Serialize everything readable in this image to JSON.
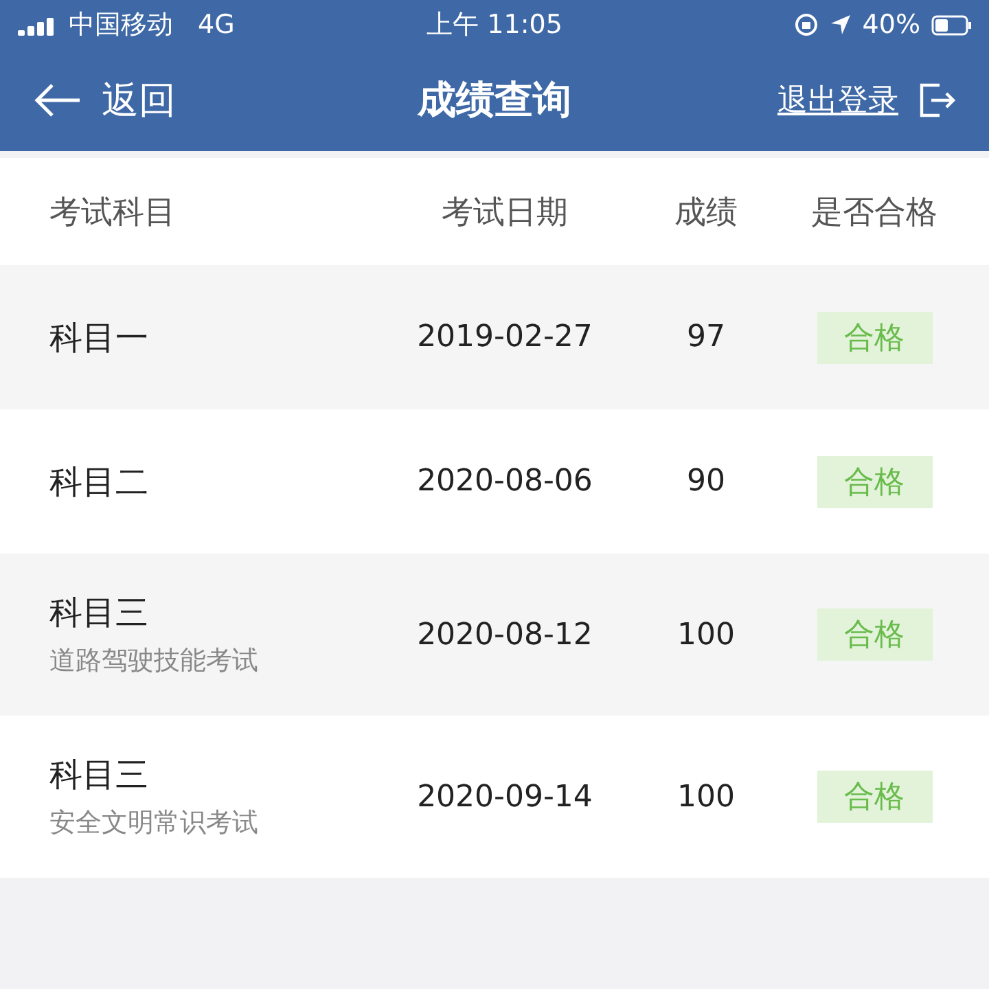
{
  "status_bar": {
    "carrier": "中国移动",
    "network": "4G",
    "time": "上午 11:05",
    "battery": "40%"
  },
  "nav": {
    "back": "返回",
    "title": "成绩查询",
    "logout": "退出登录"
  },
  "table": {
    "columns": [
      "考试科目",
      "考试日期",
      "成绩",
      "是否合格"
    ],
    "rows": [
      {
        "subject": "科目一",
        "date": "2019-02-27",
        "score": "97",
        "result": "合格",
        "passed": true
      },
      {
        "subject": "科目二",
        "date": "2020-08-06",
        "score": "90",
        "result": "合格",
        "passed": true
      },
      {
        "subject": "科目三",
        "note": "道路驾驶技能考试",
        "date": "2020-08-12",
        "score": "100",
        "result": "合格",
        "passed": true
      },
      {
        "subject": "科目三",
        "note": "安全文明常识考试",
        "date": "2020-09-14",
        "score": "100",
        "result": "合格",
        "passed": true
      }
    ]
  }
}
